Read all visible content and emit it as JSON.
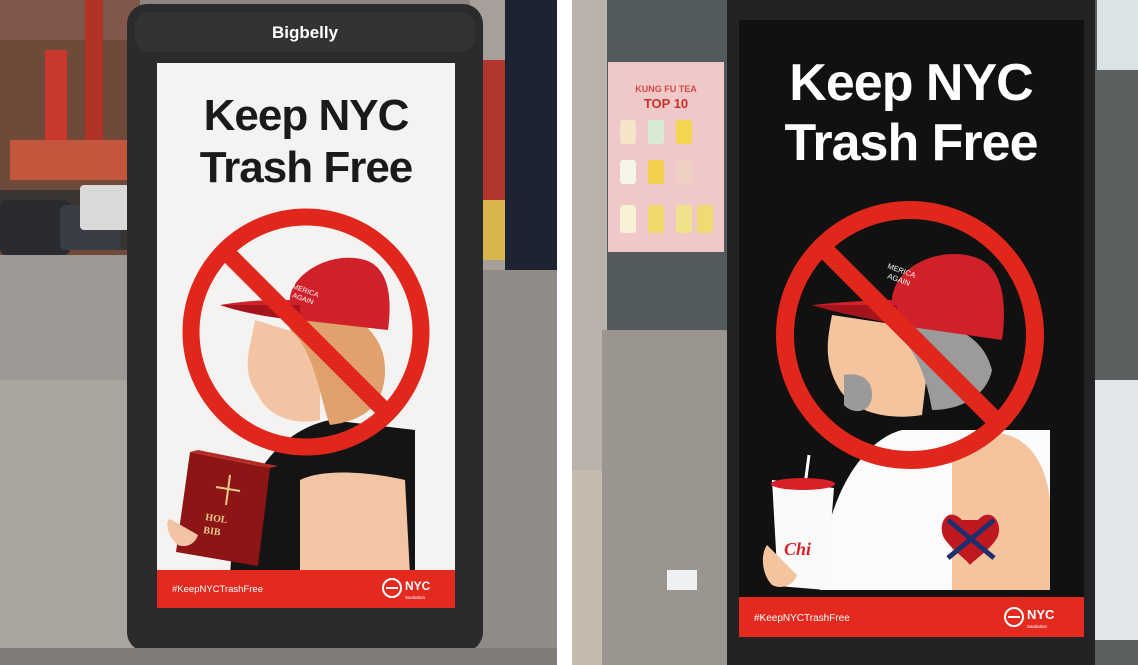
{
  "left_photo": {
    "brand": "Bigbelly",
    "headline_line1": "Keep NYC",
    "headline_line2": "Trash Free",
    "hat_text_line1": "MERICA",
    "hat_text_line2": "AGAIN",
    "book_text_line1": "HOL",
    "book_text_line2": "BIB",
    "hashtag": "#KeepNYCTrashFree",
    "logo_text": "NYC",
    "logo_subtext": "Sanitation"
  },
  "right_photo": {
    "store_sign_line1": "KUNG FU TEA",
    "store_sign_line2": "TOP 10",
    "headline_line1": "Keep NYC",
    "headline_line2": "Trash Free",
    "hat_text_line1": "MERICA",
    "hat_text_line2": "AGAIN",
    "cup_text": "Chi",
    "hashtag": "#KeepNYCTrashFree",
    "logo_text": "NYC",
    "logo_subtext": "Sanitation"
  },
  "colors": {
    "no_symbol_red": "#e1261c",
    "banner_red": "#e42a1f",
    "hat_red": "#c8161d",
    "left_panel_bg": "#f5f3f2",
    "right_panel_bg": "#111111",
    "bin_dark": "#2b2b2d"
  }
}
